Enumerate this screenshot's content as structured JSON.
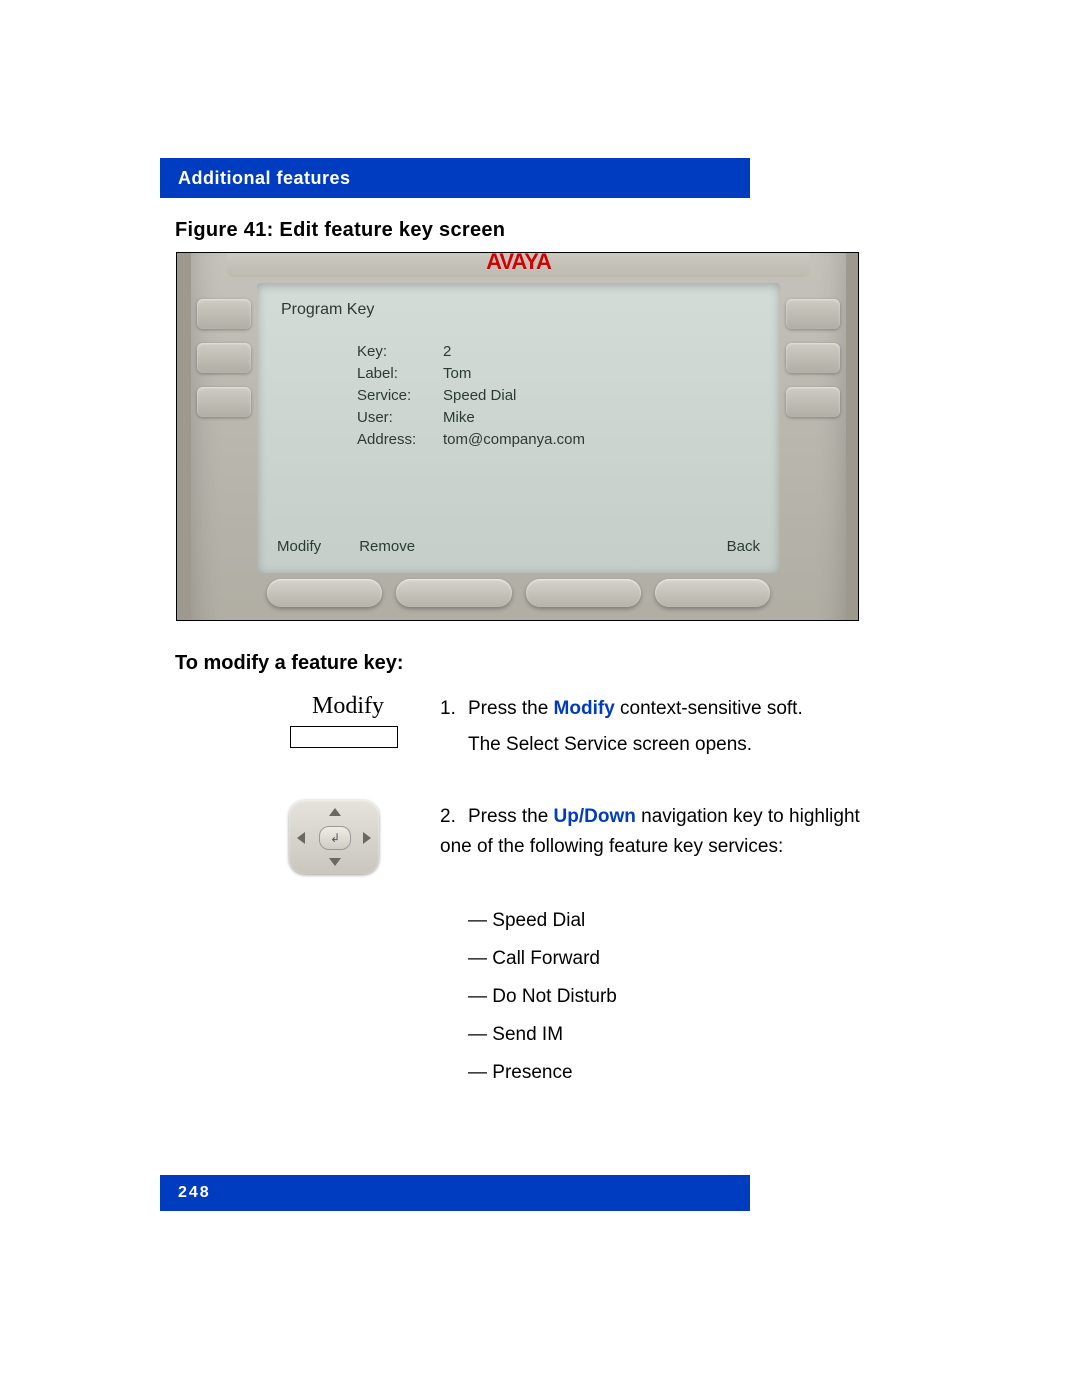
{
  "header": {
    "section_title": "Additional features"
  },
  "figure": {
    "caption": "Figure 41: Edit feature key screen"
  },
  "device": {
    "brand": "AVAYA",
    "screen_title": "Program Key",
    "fields": {
      "key_label": "Key:",
      "key_value": "2",
      "label_label": "Label:",
      "label_value": "Tom",
      "service_label": "Service:",
      "service_value": "Speed Dial",
      "user_label": "User:",
      "user_value": "Mike",
      "address_label": "Address:",
      "address_value": "tom@companya.com"
    },
    "softkeys": {
      "k1": "Modify",
      "k2": "Remove",
      "k3": "Back"
    }
  },
  "section": {
    "heading": "To modify a feature key:"
  },
  "controls": {
    "modify_label": "Modify"
  },
  "steps": {
    "s1_num": "1.",
    "s1_pre": "Press the ",
    "s1_bold": "Modify",
    "s1_post": " context-sensitive soft.",
    "s1_line2": "The Select Service screen opens.",
    "s2_num": "2.",
    "s2_pre": "Press the ",
    "s2_bold": "Up/Down",
    "s2_post": " navigation key to highlight one of the following feature key services:"
  },
  "bullets": {
    "b1": "—   Speed Dial",
    "b2": "—   Call Forward",
    "b3": "—   Do Not Disturb",
    "b4": "—   Send IM",
    "b5": "—   Presence"
  },
  "footer": {
    "page_number": "248"
  }
}
